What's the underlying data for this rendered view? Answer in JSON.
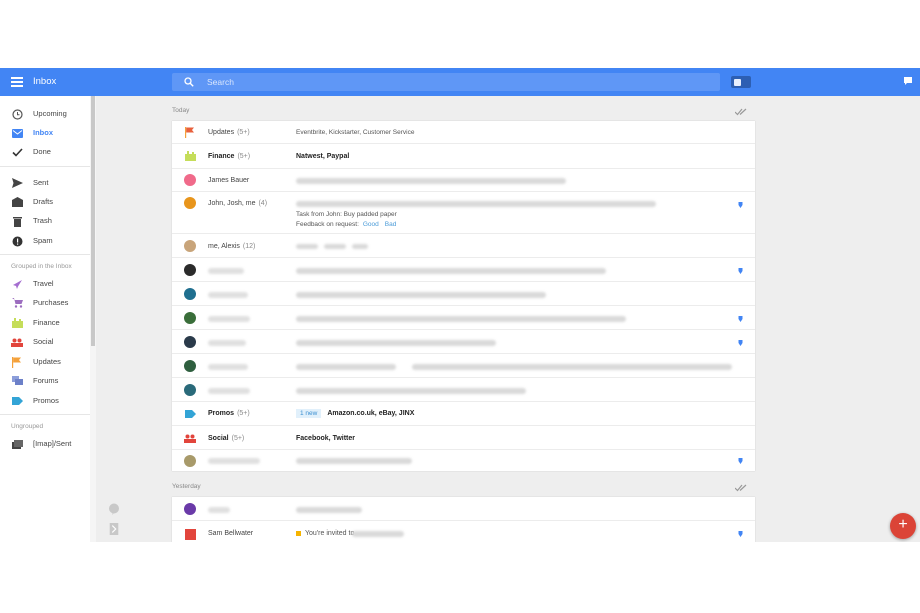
{
  "header": {
    "title": "Inbox",
    "search_placeholder": "Search",
    "accent_color": "#4285f4"
  },
  "sidebar": {
    "primary": [
      {
        "label": "Upcoming",
        "icon": "clock-icon"
      },
      {
        "label": "Inbox",
        "icon": "inbox-icon",
        "active": true
      },
      {
        "label": "Done",
        "icon": "check-icon"
      }
    ],
    "secondary": [
      {
        "label": "Sent",
        "icon": "send-icon"
      },
      {
        "label": "Drafts",
        "icon": "drafts-icon"
      },
      {
        "label": "Trash",
        "icon": "trash-icon"
      },
      {
        "label": "Spam",
        "icon": "spam-icon"
      }
    ],
    "grouped_heading": "Grouped in the Inbox",
    "grouped": [
      {
        "label": "Travel",
        "icon": "plane-icon"
      },
      {
        "label": "Purchases",
        "icon": "cart-icon"
      },
      {
        "label": "Finance",
        "icon": "finance-icon"
      },
      {
        "label": "Social",
        "icon": "people-icon"
      },
      {
        "label": "Updates",
        "icon": "flag-icon"
      },
      {
        "label": "Forums",
        "icon": "forums-icon"
      },
      {
        "label": "Promos",
        "icon": "tag-icon"
      }
    ],
    "ungrouped_heading": "Ungrouped",
    "ungrouped": [
      {
        "label": "[Imap]/Sent",
        "icon": "folder-icon"
      }
    ]
  },
  "today": {
    "label": "Today",
    "rows": [
      {
        "sender": "Updates",
        "count": "(5+)",
        "subject": "Eventbrite, Kickstarter, Customer Service",
        "icon": "flag-icon"
      },
      {
        "sender": "Finance",
        "count": "(5+)",
        "subject": "Natwest, Paypal",
        "icon": "finance-icon"
      },
      {
        "sender": "James Bauer",
        "count": "",
        "subject": "",
        "icon": "avatar"
      },
      {
        "sender": "John, Josh, me",
        "count": "(4)",
        "subject": "Task from John: Buy padded paper",
        "reply_prompt": "Feedback on request:",
        "reply_good": "Good",
        "reply_bad": "Bad",
        "icon": "avatar"
      },
      {
        "sender": "me, Alexis",
        "count": "(12)",
        "subject": "",
        "icon": "avatar"
      },
      {
        "sender": "",
        "subject": "",
        "icon": "avatar"
      },
      {
        "sender": "",
        "subject": "",
        "icon": "avatar"
      },
      {
        "sender": "",
        "subject": "",
        "icon": "avatar"
      },
      {
        "sender": "",
        "subject": "",
        "icon": "avatar"
      },
      {
        "sender": "",
        "subject": "",
        "icon": "avatar"
      },
      {
        "sender": "",
        "subject": "",
        "icon": "avatar"
      },
      {
        "sender": "Promos",
        "count": "(5+)",
        "badge": "1 new",
        "subject": "Amazon.co.uk, eBay, JINX",
        "icon": "tag-icon"
      },
      {
        "sender": "Social",
        "count": "(5+)",
        "subject": "Facebook, Twitter",
        "icon": "people-icon"
      },
      {
        "sender": "",
        "subject": "",
        "icon": "avatar"
      }
    ]
  },
  "yesterday": {
    "label": "Yesterday",
    "rows": [
      {
        "sender": "",
        "subject": "",
        "icon": "avatar"
      },
      {
        "sender": "Sam Bellwater",
        "subject": "You're invited to",
        "icon": "avatar"
      }
    ]
  },
  "fab": {
    "label": "+"
  }
}
